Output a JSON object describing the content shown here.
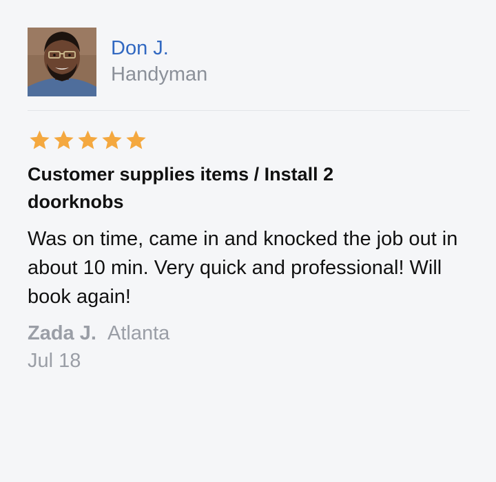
{
  "pro": {
    "name": "Don J.",
    "role": "Handyman",
    "avatar_icon": "person-photo"
  },
  "review": {
    "rating": 5,
    "rating_max": 5,
    "star_color": "#f4a83f",
    "title": "Customer supplies items / Install 2 doorknobs",
    "body": "Was on time, came in and knocked the job out in about 10 min. Very quick and professional! Will book again!",
    "reviewer": "Zada J.",
    "location": "Atlanta",
    "date": "Jul 18"
  },
  "colors": {
    "link": "#3168c1",
    "muted": "#8b9099",
    "background": "#f5f6f8"
  }
}
